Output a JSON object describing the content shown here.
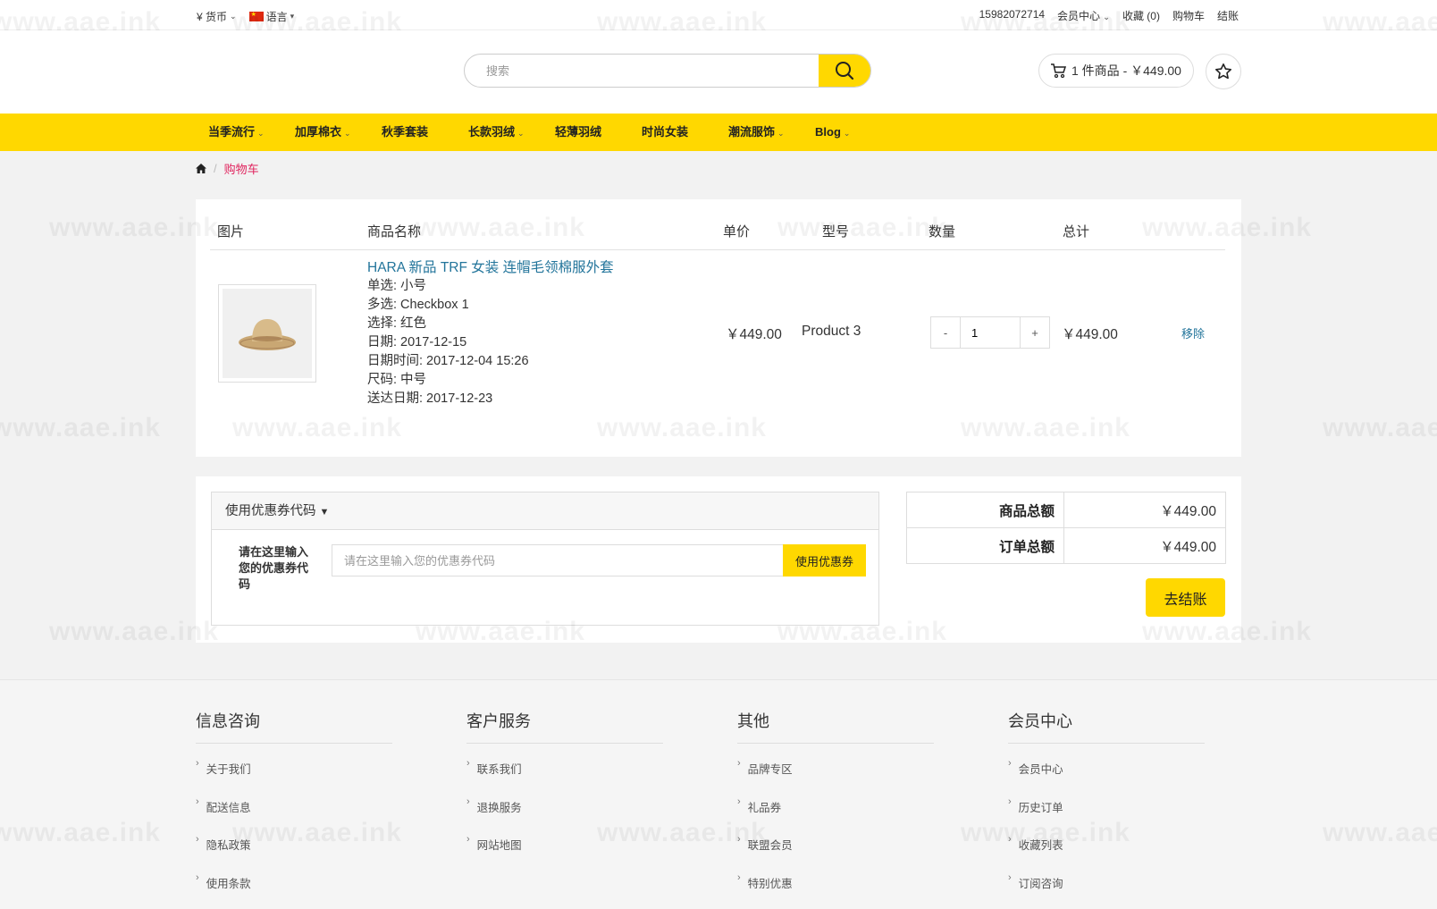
{
  "topbar": {
    "currency": "¥ 货币",
    "language": "语言",
    "phone": "15982072714",
    "member": "会员中心",
    "wishlist": "收藏 (0)",
    "cart": "购物车",
    "checkout": "结账"
  },
  "search": {
    "placeholder": "搜索"
  },
  "header": {
    "cart_summary": "1 件商品 - ￥449.00"
  },
  "nav": {
    "items": [
      {
        "label": "当季流行",
        "dropdown": true
      },
      {
        "label": "加厚棉衣",
        "dropdown": true
      },
      {
        "label": "秋季套装",
        "dropdown": false
      },
      {
        "label": "长款羽绒",
        "dropdown": true
      },
      {
        "label": "轻薄羽绒",
        "dropdown": false
      },
      {
        "label": "时尚女装",
        "dropdown": false
      },
      {
        "label": "潮流服饰",
        "dropdown": true
      },
      {
        "label": "Blog",
        "dropdown": true
      }
    ]
  },
  "breadcrumb": {
    "current": "购物车"
  },
  "cart_table": {
    "headers": {
      "image": "图片",
      "name": "商品名称",
      "price": "单价",
      "model": "型号",
      "quantity": "数量",
      "total": "总计"
    },
    "item": {
      "name": "HARA 新品 TRF 女装 连帽毛领棉服外套",
      "options": [
        "单选: 小号",
        "多选: Checkbox 1",
        "选择: 红色",
        "日期: 2017-12-15",
        "日期时间: 2017-12-04 15:26",
        "尺码: 中号",
        "送达日期: 2017-12-23"
      ],
      "price": "￥449.00",
      "model": "Product 3",
      "quantity": "1",
      "minus": "-",
      "plus": "+",
      "total": "￥449.00",
      "remove": "移除"
    }
  },
  "coupon": {
    "title": "使用优惠券代码",
    "label": "请在这里输入您的优惠券代码",
    "placeholder": "请在这里输入您的优惠券代码",
    "apply": "使用优惠券"
  },
  "totals": {
    "subtotal_label": "商品总额",
    "subtotal_value": "￥449.00",
    "total_label": "订单总额",
    "total_value": "￥449.00",
    "checkout_button": "去结账"
  },
  "footer": {
    "columns": [
      {
        "title": "信息咨询",
        "links": [
          "关于我们",
          "配送信息",
          "隐私政策",
          "使用条款"
        ]
      },
      {
        "title": "客户服务",
        "links": [
          "联系我们",
          "退换服务",
          "网站地图"
        ]
      },
      {
        "title": "其他",
        "links": [
          "品牌专区",
          "礼品券",
          "联盟会员",
          "特别优惠"
        ]
      },
      {
        "title": "会员中心",
        "links": [
          "会员中心",
          "历史订单",
          "收藏列表",
          "订阅咨询"
        ]
      }
    ]
  },
  "watermark": "www.aae.ink",
  "colors": {
    "accent": "#ffd800",
    "link": "#23759b",
    "breadcrumb_active": "#e0245e"
  }
}
